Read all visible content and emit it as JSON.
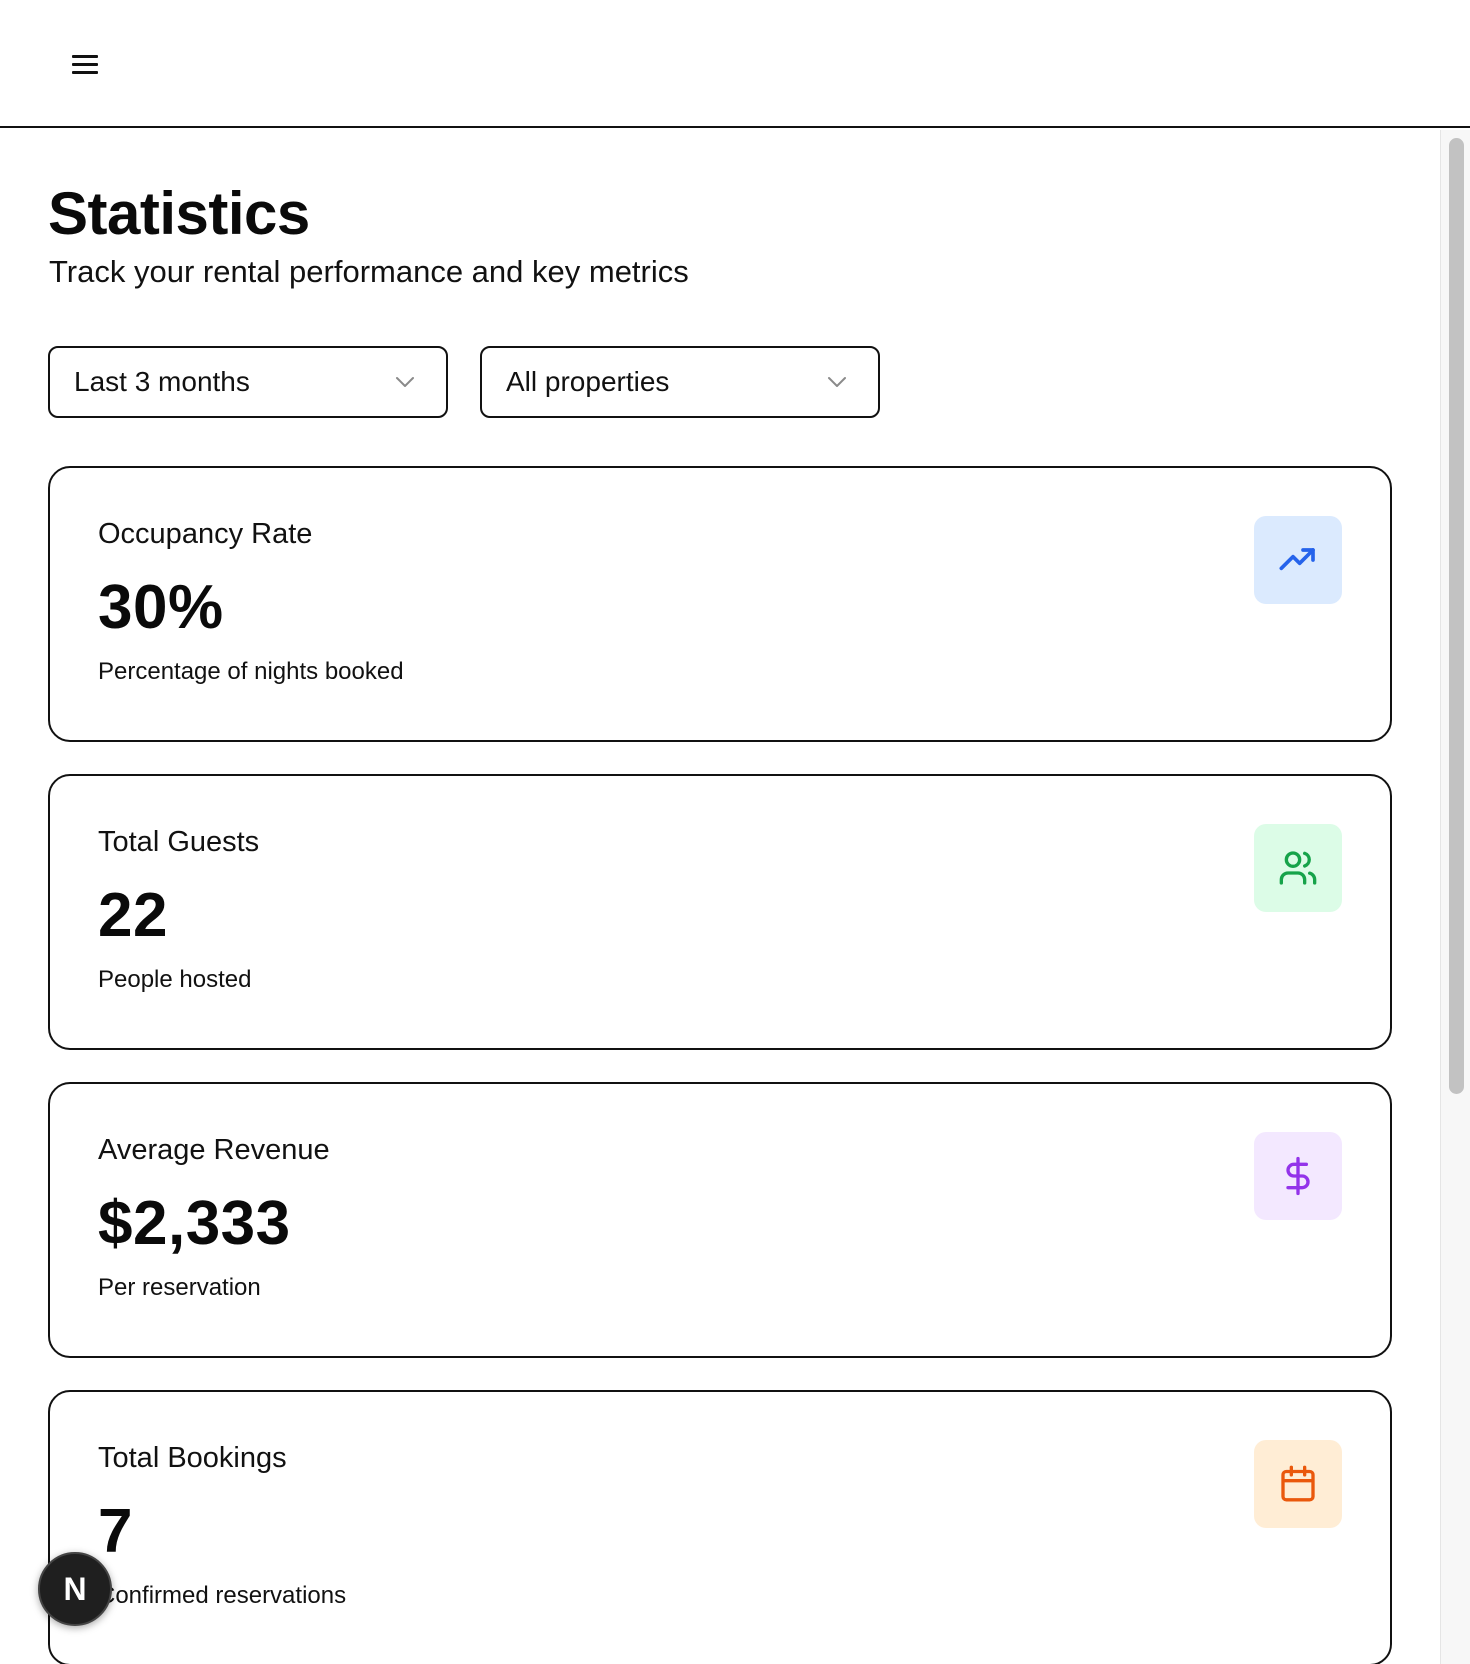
{
  "header": {
    "menu_icon": "hamburger-menu-icon"
  },
  "page": {
    "title": "Statistics",
    "subtitle": "Track your rental performance and key metrics"
  },
  "filters": {
    "period": {
      "selected": "Last 3 months",
      "icon": "chevron-down-icon"
    },
    "property": {
      "selected": "All properties",
      "icon": "chevron-down-icon"
    }
  },
  "cards": [
    {
      "label": "Occupancy Rate",
      "value": "30%",
      "caption": "Percentage of nights booked",
      "icon": "trending-up-icon",
      "icon_color": "#2563eb",
      "icon_bg": "#dbeafe"
    },
    {
      "label": "Total Guests",
      "value": "22",
      "caption": "People hosted",
      "icon": "users-icon",
      "icon_color": "#16a34a",
      "icon_bg": "#dcfce7"
    },
    {
      "label": "Average Revenue",
      "value": "$2,333",
      "caption": "Per reservation",
      "icon": "dollar-sign-icon",
      "icon_color": "#9333ea",
      "icon_bg": "#f3e8ff"
    },
    {
      "label": "Total Bookings",
      "value": "7",
      "caption": "Confirmed reservations",
      "icon": "calendar-icon",
      "icon_color": "#ea580c",
      "icon_bg": "#ffedd5"
    }
  ],
  "dev_badge": {
    "label": "N"
  }
}
